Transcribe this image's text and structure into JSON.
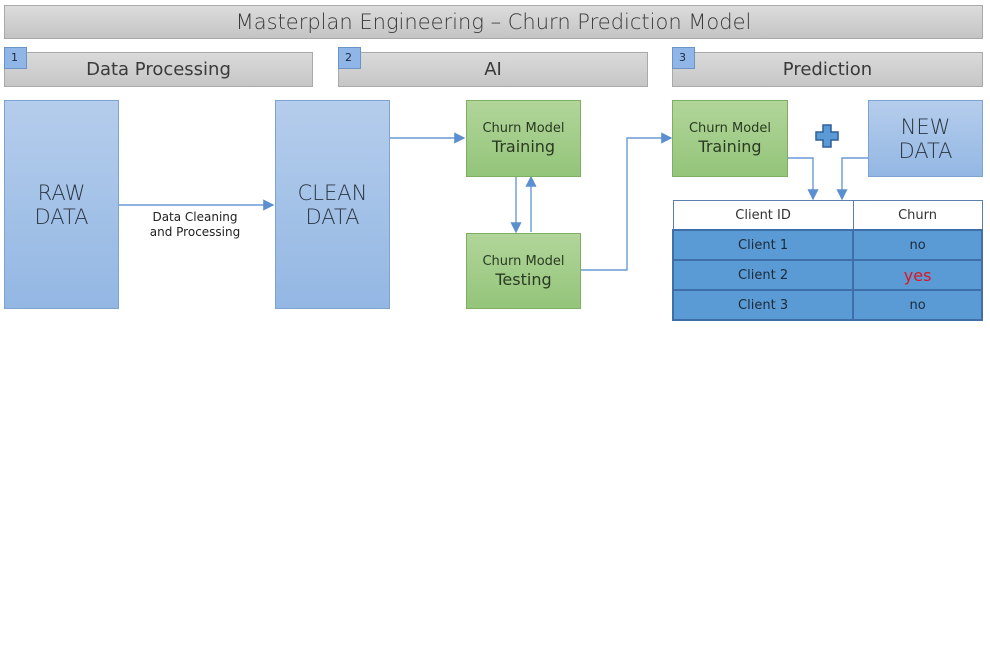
{
  "title": "Masterplan Engineering – Churn Prediction Model",
  "sections": [
    {
      "number": "1",
      "label": "Data Processing"
    },
    {
      "number": "2",
      "label": "AI"
    },
    {
      "number": "3",
      "label": "Prediction"
    }
  ],
  "nodes": {
    "raw_data": {
      "line1": "RAW",
      "line2": "DATA"
    },
    "clean_data": {
      "line1": "CLEAN",
      "line2": "DATA"
    },
    "training_ai": {
      "line1": "Churn Model",
      "line2": "Training"
    },
    "testing_ai": {
      "line1": "Churn Model",
      "line2": "Testing"
    },
    "training_pred": {
      "line1": "Churn Model",
      "line2": "Training"
    },
    "new_data": {
      "line1": "NEW",
      "line2": "DATA"
    }
  },
  "edges": {
    "cleaning_label_line1": "Data Cleaning",
    "cleaning_label_line2": "and Processing"
  },
  "plus_icon": "plus-icon",
  "colors": {
    "blue_box": "#9fbfe6",
    "green_box": "#a3cd87",
    "table_row": "#5b9bd5",
    "churn_yes": "#e0141e",
    "badge": "#8fb6e6"
  },
  "table": {
    "headers": [
      "Client ID",
      "Churn"
    ],
    "rows": [
      [
        "Client 1",
        "no"
      ],
      [
        "Client 2",
        "yes"
      ],
      [
        "Client 3",
        "no"
      ]
    ]
  }
}
